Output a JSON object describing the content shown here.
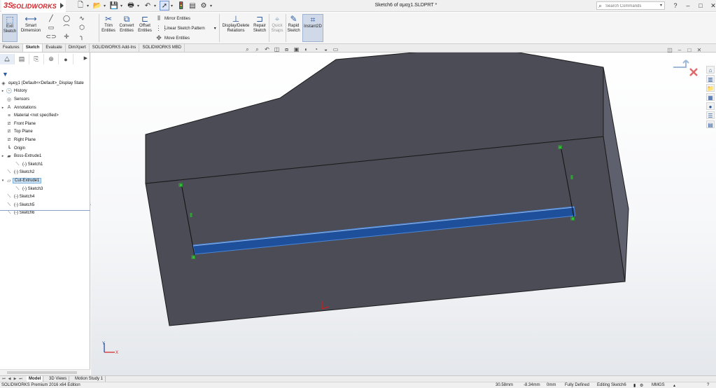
{
  "app": {
    "logo_mark": "3S",
    "logo_name": "SOLIDWORKS",
    "document_title": "Sketch6 of αμαχ1.SLDPRT *"
  },
  "search": {
    "placeholder": "Search Commands"
  },
  "window_buttons": [
    "?",
    "–",
    "□",
    "✕"
  ],
  "command_manager": {
    "exit_sketch": "Exit Sketch",
    "smart_dimension": "Smart Dimension",
    "trim_entities": "Trim Entities",
    "convert_entities": "Convert Entities",
    "offset_entities": "Offset Entities",
    "mirror_entities": "Mirror Entities",
    "linear_sketch_pattern": "Linear Sketch Pattern",
    "move_entities": "Move Entities",
    "display_delete_relations": "Display/Delete Relations",
    "repair_sketch": "Repair Sketch",
    "quick_snaps": "Quick Snaps",
    "rapid_sketch": "Rapid Sketch",
    "instant2d": "Instant2D"
  },
  "command_tabs": [
    "Features",
    "Sketch",
    "Evaluate",
    "DimXpert",
    "SOLIDWORKS Add-Ins",
    "SOLIDWORKS MBD"
  ],
  "active_command_tab": "Sketch",
  "feature_tree": {
    "root": "αμαχ1  (Default<<Default>_Display State",
    "items": [
      {
        "label": "History",
        "icon": "history-icon",
        "expand": true
      },
      {
        "label": "Sensors",
        "icon": "sensor-icon",
        "expand": false
      },
      {
        "label": "Annotations",
        "icon": "annotations-icon",
        "expand": true
      },
      {
        "label": "Material <not specified>",
        "icon": "material-icon",
        "expand": false
      },
      {
        "label": "Front Plane",
        "icon": "plane-icon",
        "expand": false
      },
      {
        "label": "Top Plane",
        "icon": "plane-icon",
        "expand": false
      },
      {
        "label": "Right Plane",
        "icon": "plane-icon",
        "expand": false
      },
      {
        "label": "Origin",
        "icon": "origin-icon",
        "expand": false
      },
      {
        "label": "Boss-Extrude1",
        "icon": "boss-extrude-icon",
        "expand": true
      },
      {
        "label": "(-) Sketch1",
        "icon": "sketch-icon",
        "indent": true
      },
      {
        "label": "(-) Sketch2",
        "icon": "sketch-icon",
        "expand": false
      },
      {
        "label": "Cut-Extrude1",
        "icon": "cut-extrude-icon",
        "expand": true,
        "highlight": true
      },
      {
        "label": "(-) Sketch3",
        "icon": "sketch-icon",
        "indent": true
      },
      {
        "label": "(-) Sketch4",
        "icon": "sketch-icon",
        "expand": false
      },
      {
        "label": "(-) Sketch5",
        "icon": "sketch-icon",
        "expand": false
      },
      {
        "label": "(-) Sketch6",
        "icon": "sketch-icon",
        "expand": false
      }
    ]
  },
  "bottom_tabs": [
    "Model",
    "3D Views",
    "Motion Study 1"
  ],
  "active_bottom_tab": "Model",
  "status": {
    "edition": "SOLIDWORKS Premium 2016 x64 Edition",
    "x": "30.58mm",
    "y": "-8.34mm",
    "z": "0mm",
    "definition": "Fully Defined",
    "editing": "Editing Sketch6",
    "units": "MMGS"
  },
  "colors": {
    "model_face": "#4b4c56",
    "model_side": "#5f606d",
    "slot": "#1d4f9a",
    "relation_green": "#22d022",
    "accent": "#2c5aa0"
  }
}
